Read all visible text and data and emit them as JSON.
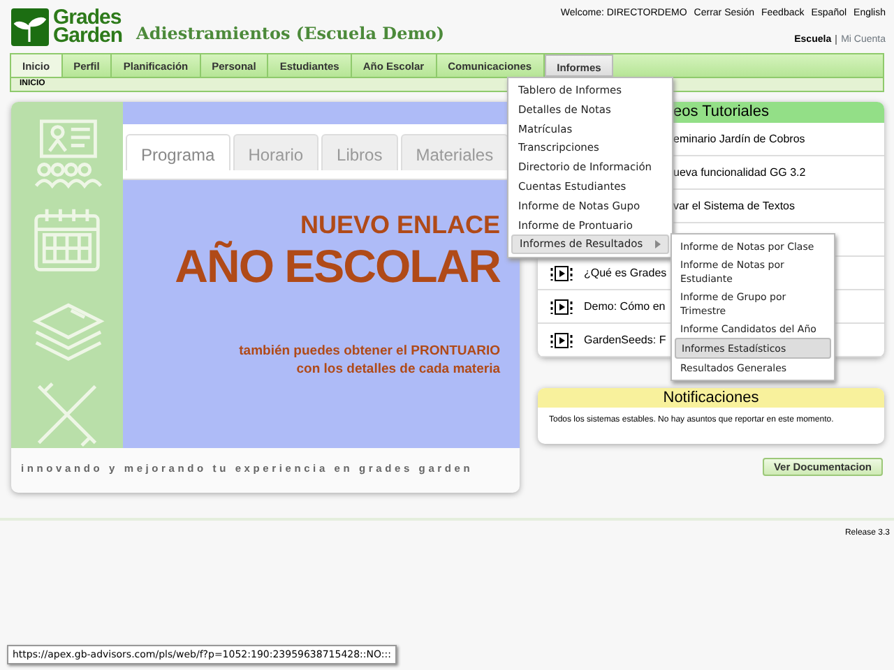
{
  "header": {
    "logo_line1": "Grades",
    "logo_line2": "Garden",
    "title": "Adiestramientos (Escuela Demo)",
    "top_links": [
      "Welcome: DIRECTORDEMO",
      "Cerrar Sesión",
      "Feedback",
      "Español",
      "English"
    ],
    "account_links": [
      {
        "label": "Escuela",
        "selected": true
      },
      {
        "label": "Mi Cuenta",
        "selected": false
      }
    ]
  },
  "nav_tabs": [
    {
      "label": "Inicio",
      "selected": true,
      "expanded": false
    },
    {
      "label": "Perfil",
      "selected": false,
      "expanded": false
    },
    {
      "label": "Planificación",
      "selected": false,
      "expanded": false
    },
    {
      "label": "Personal",
      "selected": false,
      "expanded": false
    },
    {
      "label": "Estudiantes",
      "selected": false,
      "expanded": false
    },
    {
      "label": "Año Escolar",
      "selected": false,
      "expanded": false
    },
    {
      "label": "Comunicaciones",
      "selected": false,
      "expanded": false
    },
    {
      "label": "Informes",
      "selected": false,
      "expanded": true
    }
  ],
  "breadcrumb": "INICIO",
  "menu": [
    {
      "label": "Tablero de Informes",
      "has_submenu": false,
      "selected": false
    },
    {
      "label": "Detalles de Notas",
      "has_submenu": false,
      "selected": false
    },
    {
      "label": "Matrículas",
      "has_submenu": false,
      "selected": false
    },
    {
      "label": "Transcripciones",
      "has_submenu": false,
      "selected": false
    },
    {
      "label": "Directorio de Información",
      "has_submenu": false,
      "selected": false
    },
    {
      "label": "Cuentas Estudiantes",
      "has_submenu": false,
      "selected": false
    },
    {
      "label": "Informe de Notas Gupo",
      "has_submenu": false,
      "selected": false
    },
    {
      "label": "Informe de Prontuario",
      "has_submenu": false,
      "selected": false
    },
    {
      "label": "Informes de Resultados",
      "has_submenu": true,
      "selected": true
    }
  ],
  "submenu": [
    {
      "label": "Informe de Notas por Clase",
      "selected": false
    },
    {
      "label": "Informe de Notas por Estudiante",
      "selected": false
    },
    {
      "label": "Informe de Grupo por Trimestre",
      "selected": false
    },
    {
      "label": "Informe Candidatos del Año",
      "selected": false
    },
    {
      "label": "Informes Estadísticos",
      "selected": true
    },
    {
      "label": "Resultados Generales",
      "selected": false
    }
  ],
  "banner": {
    "tabs": [
      {
        "label": "Programa",
        "selected": true
      },
      {
        "label": "Horario",
        "selected": false
      },
      {
        "label": "Libros",
        "selected": false
      },
      {
        "label": "Materiales",
        "selected": false
      }
    ],
    "headline_small": "NUEVO ENLACE",
    "headline": "AÑO ESCOLAR",
    "subtext_line1": "también puedes obtener el PRONTUARIO",
    "subtext_line2": "con los detalles de cada materia",
    "tagline": "innovando y mejorando tu experiencia en grades garden"
  },
  "videos": {
    "title": "eos Tutoriales",
    "rows": [
      {
        "kind": "partial",
        "text": "eminario Jardín de Cobros"
      },
      {
        "kind": "partial",
        "text": "ueva funcionalidad GG 3.2"
      },
      {
        "kind": "partial",
        "text": "var el Sistema de Textos"
      },
      {
        "kind": "hidden"
      },
      {
        "kind": "full",
        "text": "¿Qué es Grades"
      },
      {
        "kind": "full",
        "text": "Demo: Cómo en"
      },
      {
        "kind": "full",
        "text": "GardenSeeds: F"
      }
    ]
  },
  "notifications": {
    "title": "Notificaciones",
    "message": "Todos los sistemas estables. No hay asuntos que reportar en este momento."
  },
  "doc_button": "Ver Documentacion",
  "release": "Release 3.3",
  "status_url": "https://apex.gb-advisors.com/pls/web/f?p=1052:190:23959638715428::NO:::"
}
